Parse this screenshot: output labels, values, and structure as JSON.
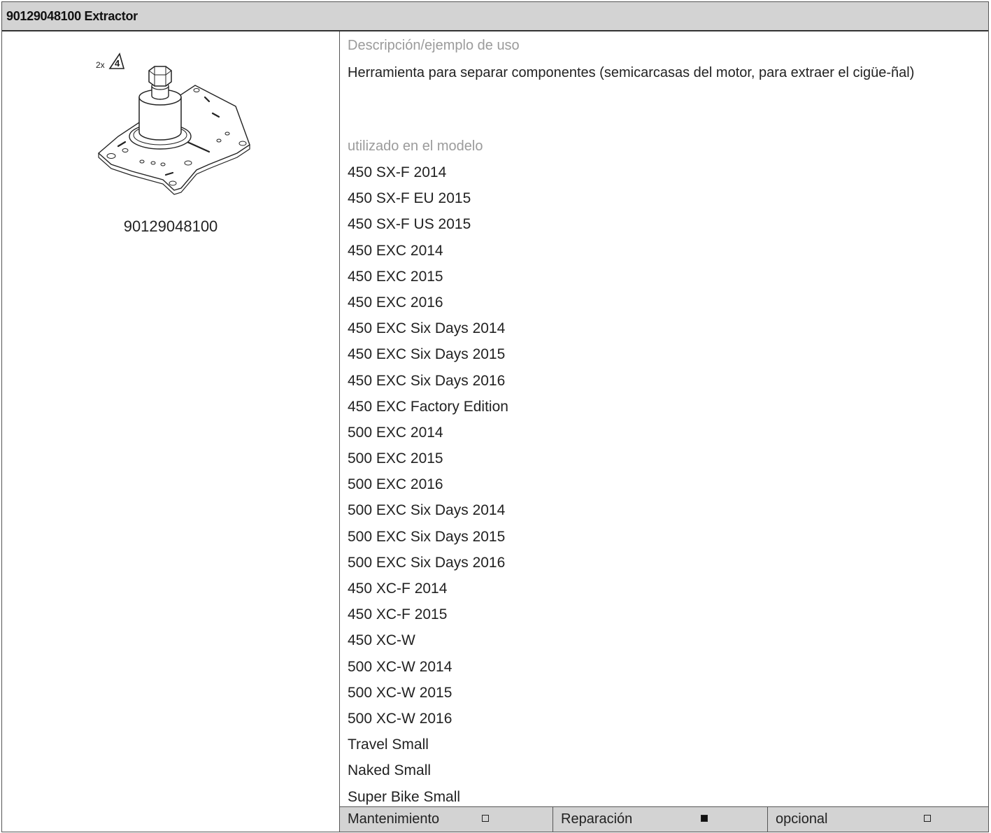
{
  "header": {
    "title": "90129048100 Extractor"
  },
  "figure": {
    "quantity_label": "2x",
    "warning_number": "4",
    "icon": "extractor-tool-illustration"
  },
  "tool_code": "90129048100",
  "description": {
    "label": "Descripción/ejemplo de uso",
    "text": "Herramienta para separar componentes (semicarcasas del motor, para extraer el cigüe-ñal)"
  },
  "models": {
    "label": "utilizado en el modelo",
    "items": [
      "450 SX-F 2014",
      "450 SX-F EU 2015",
      "450 SX-F US 2015",
      "450 EXC 2014",
      "450 EXC 2015",
      "450 EXC 2016",
      "450 EXC Six Days 2014",
      "450 EXC Six Days 2015",
      "450 EXC Six Days 2016",
      "450 EXC Factory Edition",
      "500 EXC 2014",
      "500 EXC 2015",
      "500 EXC 2016",
      "500 EXC Six Days 2014",
      "500 EXC Six Days 2015",
      "500 EXC Six Days 2016",
      "450 XC-F 2014",
      "450 XC-F 2015",
      "450 XC-W",
      "500 XC-W 2014",
      "500 XC-W 2015",
      "500 XC-W 2016",
      "Travel Small",
      "Naked Small",
      "Super Bike Small"
    ]
  },
  "footer": [
    {
      "label": "Mantenimiento",
      "checked": false
    },
    {
      "label": "Reparación",
      "checked": true
    },
    {
      "label": "opcional",
      "checked": false
    }
  ]
}
